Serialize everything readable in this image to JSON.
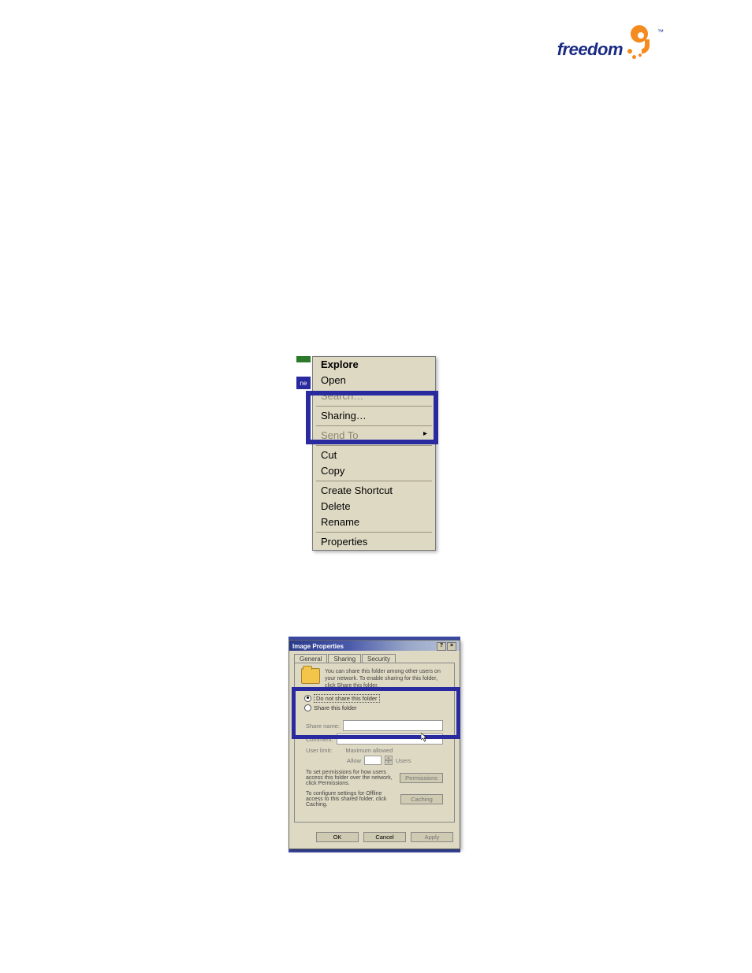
{
  "logo": {
    "brand": "freedom",
    "tm": "™"
  },
  "context_menu": {
    "items": [
      {
        "label": "Explore",
        "bold": true
      },
      {
        "label": "Open"
      },
      {
        "label": "Search…",
        "faded": true
      },
      {
        "sep": true
      },
      {
        "label": "Sharing…",
        "highlight": true
      },
      {
        "sep": true
      },
      {
        "label": "Send To",
        "submenu": true,
        "faded": true
      },
      {
        "sep": true
      },
      {
        "label": "Cut"
      },
      {
        "label": "Copy"
      },
      {
        "sep": true
      },
      {
        "label": "Create Shortcut"
      },
      {
        "label": "Delete"
      },
      {
        "label": "Rename"
      },
      {
        "sep": true
      },
      {
        "label": "Properties"
      }
    ],
    "side_tab": "ne"
  },
  "dialog": {
    "title": "Image Properties",
    "tabs": [
      "General",
      "Sharing",
      "Security"
    ],
    "active_tab": "Sharing",
    "description": "You can share this folder among other users on your network. To enable sharing for this folder, click Share this folder.",
    "radio_not_share": "Do not share this folder",
    "radio_share": "Share this folder",
    "share_name_label": "Share name:",
    "comment_label": "Comment:",
    "user_limit_label": "User limit:",
    "max_allowed": "Maximum allowed",
    "allow_label": "Allow",
    "users_label": "Users",
    "perm_text": "To set permissions for how users access this folder over the network, click Permissions.",
    "perm_button": "Permissions",
    "cache_text": "To configure settings for Offline access to this shared folder, click Caching.",
    "cache_button": "Caching",
    "ok": "OK",
    "cancel": "Cancel",
    "apply": "Apply"
  }
}
